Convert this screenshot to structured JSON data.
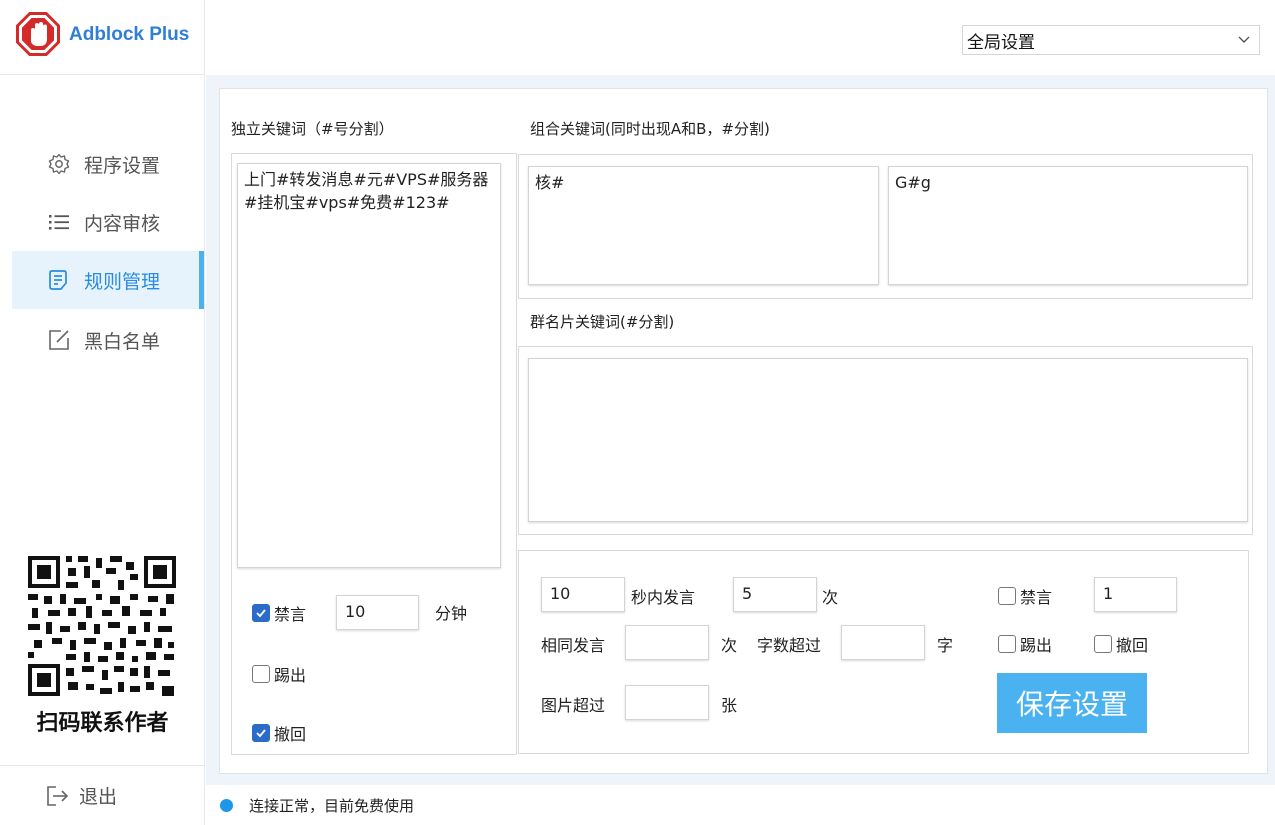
{
  "app": {
    "brand": "Adblock Plus"
  },
  "sidebar": {
    "items": [
      {
        "label": "程序设置",
        "icon": "gear-icon"
      },
      {
        "label": "内容审核",
        "icon": "list-icon"
      },
      {
        "label": "规则管理",
        "icon": "document-icon",
        "active": true
      },
      {
        "label": "黑白名单",
        "icon": "edit-icon"
      }
    ],
    "qr_caption": "扫码联系作者",
    "logout_label": "退出"
  },
  "header": {
    "scope_select": "全局设置"
  },
  "rules": {
    "standalone_label": "独立关键词（#号分割）",
    "standalone_value": "上门#转发消息#元#VPS#服务器#挂机宝#vps#免费#123#",
    "combo_label": "组合关键词(同时出现A和B，#分割)",
    "combo_a_value": "核#",
    "combo_b_value": "G#g",
    "group_card_label": "群名片关键词(#分割)",
    "group_card_value": ""
  },
  "left_actions": {
    "mute_label": "禁言",
    "mute_checked": true,
    "mute_minutes": "10",
    "minutes_unit": "分钟",
    "kick_label": "踢出",
    "kick_checked": false,
    "recall_label": "撤回",
    "recall_checked": true
  },
  "flood": {
    "seconds_value": "10",
    "seconds_label": "秒内发言",
    "count_value": "5",
    "count_unit": "次",
    "mute_label": "禁言",
    "mute_checked": false,
    "mute_value": "1",
    "same_msg_label": "相同发言",
    "same_msg_value": "",
    "same_msg_unit": "次",
    "chars_label": "字数超过",
    "chars_value": "",
    "chars_unit": "字",
    "kick_label": "踢出",
    "kick_checked": false,
    "recall_label": "撤回",
    "recall_checked": false,
    "images_label": "图片超过",
    "images_value": "",
    "images_unit": "张",
    "save_label": "保存设置"
  },
  "status": {
    "text": "连接正常，目前免费使用"
  },
  "colors": {
    "accent": "#4ab2f1",
    "brand": "#2f7fd6",
    "logo_red": "#d42a2a",
    "checkbox_blue": "#2b6cc9"
  }
}
